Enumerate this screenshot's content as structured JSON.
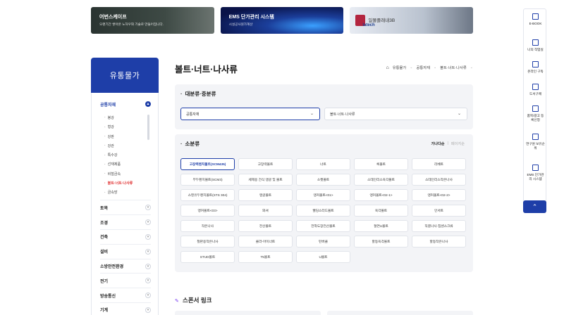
{
  "banners": [
    {
      "title": "어번스케이프",
      "subtitle": "오랜기간 쌓아온 노하우와 기술로 만들어집니다."
    },
    {
      "title": "EMS 단가관리 시스템",
      "subtitle": "시설공사원가계산"
    },
    {
      "title": "일몰플래내3B",
      "logo_text": "latech"
    }
  ],
  "sidebar": {
    "title": "유통물가",
    "categories": [
      {
        "label": "공통자재",
        "expanded": true
      },
      {
        "label": "토목"
      },
      {
        "label": "조경"
      },
      {
        "label": "건축"
      },
      {
        "label": "설비"
      },
      {
        "label": "소방안전환경"
      },
      {
        "label": "전기"
      },
      {
        "label": "방송통신"
      },
      {
        "label": "기계"
      }
    ],
    "subitems": [
      "봉강",
      "형강",
      "강판",
      "강관",
      "특수강",
      "선재제품",
      "비철금속",
      "볼트·너트·나사류",
      "금속망"
    ],
    "active_subitem": "볼트·너트·나사류"
  },
  "header": {
    "title": "볼트·너트·나사류",
    "breadcrumb": [
      "유통물가",
      "공통자재",
      "볼트·너트·나사류"
    ]
  },
  "major_category": {
    "title": "대분류·중분류",
    "select1": "공통자재",
    "select2": "볼트·너트·나사류"
  },
  "minor_category": {
    "title": "소분류",
    "sort": [
      "가나다순",
      "페이지순"
    ],
    "active_sort": "가나다순",
    "items": [
      "고장력렌치볼트(SCM435)",
      "고장력볼트",
      "너트",
      "록볼트",
      "리베트",
      "무두렌치볼트(SCM3)",
      "세제용 건식 앵글 및 볼트",
      "소켓볼트",
      "스테인리스육각볼트",
      "스테인리스작은나사",
      "스텐유두렌치볼트(STS 304)",
      "앵글볼트",
      "앵커볼트<01>",
      "앵커볼트<02-1>",
      "앵커볼트<02-2>",
      "앵커볼트<03>",
      "와셔",
      "웰딩스터드볼트",
      "육각볼트",
      "인서트",
      "작은나사",
      "전산볼트",
      "전착도장전산볼트",
      "절연U볼트",
      "직결나사·칩센스크류",
      "철판용작은나사",
      "콜라-아이너트",
      "턴버클",
      "할동육각볼트",
      "할동작은나사",
      "STUD볼트",
      "T5볼트",
      "U볼트"
    ],
    "active_item": "고장력렌치볼트(SCM435)"
  },
  "sponsor": {
    "title": "스폰서 링크"
  },
  "quick_menu": {
    "items": [
      "E-BOOK",
      "나의 작업실",
      "온라인 구독",
      "도서구매",
      "품목/광고 등록신청",
      "연구원 보유순위",
      "EMS 단가관리 시스템"
    ],
    "top_label": "^"
  },
  "colors": {
    "accent": "#1e3ea8",
    "active_red": "#e03131",
    "panel_bg": "#f3f4f7"
  }
}
